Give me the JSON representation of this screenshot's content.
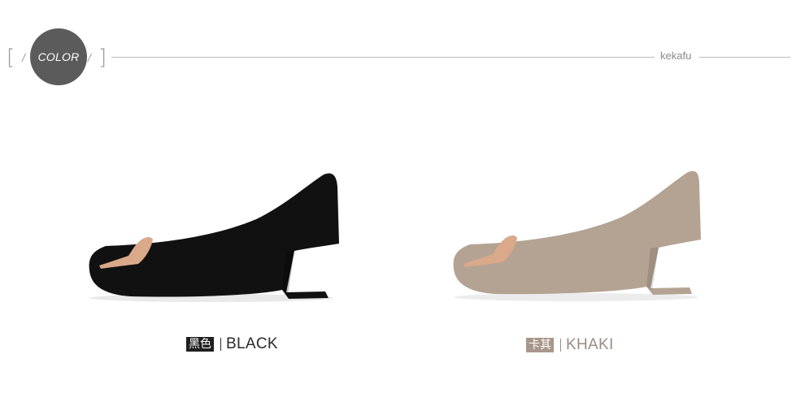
{
  "header": {
    "badge_label": "COLOR",
    "brand": "kekafu",
    "open_bracket": "[",
    "close_bracket": "]",
    "slash_left": "/",
    "slash_right": "/"
  },
  "variants": [
    {
      "tag": "黑色",
      "name": "BLACK",
      "tag_color": "#1f1f1f",
      "text_color": "#2a2a2a",
      "shoe_color": "#111111"
    },
    {
      "tag": "卡其",
      "name": "KHAKI",
      "tag_color": "#a8968a",
      "text_color": "#9c8b80",
      "shoe_color": "#b4a393"
    }
  ],
  "buckle_color": "#d9a98a"
}
